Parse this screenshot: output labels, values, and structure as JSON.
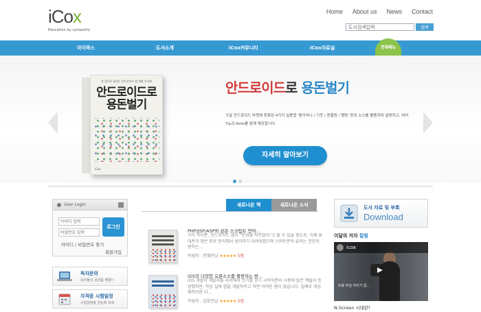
{
  "header": {
    "logo_text_i": "i",
    "logo_text_co": "Co",
    "logo_text_x": "x",
    "logo_tagline": "Education by sympathy",
    "nav": [
      "Home",
      "About us",
      "News",
      "Contact"
    ],
    "search_placeholder": "도서검색입력",
    "search_button": "검색"
  },
  "menu": {
    "items": [
      "아이콕스",
      "도서소개",
      "iCox커뮤니티",
      "iCox자료실"
    ],
    "all_menu": "전체메뉴"
  },
  "banner": {
    "book_top": "한 권으로 끝내는 안드로이드 앱 개발 수익화",
    "book_title_1": "안드로이드로",
    "book_title_2": "용돈벌기",
    "book_pub": "iCox",
    "title_red": "안드로이드",
    "title_mid": "로 ",
    "title_blue": "용돈벌기",
    "desc": "구글 안드로이드 마켓에 등록된 4가지 실용앱 '범거러니 / 기웃 / 동물원 / 행탕' 등의 소스를 활용하여 설명하고, 여러 Tip과 Note를 함께 제공합니다.",
    "button": "자세히 알아보기",
    "slide_count": 2,
    "slide_active": 1
  },
  "login": {
    "header": "User Login",
    "id_placeholder": "아이디 입력",
    "pw_placeholder": "비밀번호 입력",
    "button": "로그인",
    "find": "아이디 / 비밀번호 찾기",
    "join": "회원가입"
  },
  "side_boxes": [
    {
      "title": "독자문의",
      "sub": "독자들의 궁금증 해결!!"
    },
    {
      "title": "자격증 시험일정",
      "sub": "시험일정을 한눈에 쏙쏙"
    }
  ],
  "tabs": [
    "새로나온 책",
    "새로나온 소식"
  ],
  "books": [
    {
      "title": "PHP/JSP/ASP와 같은 스크립트 언어...",
      "desc": "가히 아이폰, 안드로이드 앱이 \"문화를 바꾸었다\"고 할 수 있을 정도로, 이제 휴대폰과 앱은 따로 분리해서 생각하기 어려워졌으며 스마트폰의 유저는 본인이 원하는...",
      "author_label": "작성자 : 한혜진님",
      "stars": "★★★★★",
      "score": "5점"
    },
    {
      "title": "iOS의 다양한 오픈소스를 활용하는 방...",
      "desc": "iOS 개발이 개발자들 사이에서 인기를 얻기 시작하면서 시중에 많은 책들이 등장했지만, 막상 실제 앱을 개발하려고 하면 어려운 점이 많습니다. 일례로 게임제작자한 다...",
      "author_label": "작성자 : 김윤민님",
      "stars": "★★★★★",
      "score": "5점"
    }
  ],
  "download": {
    "title": "도서 자료 및 부록",
    "big": "Download"
  },
  "author": {
    "heading_pre": "이달의 저자 ",
    "heading_hl": "칼럼",
    "video_channel": "icox",
    "video_caption": "또봉 주님 어이가 없...",
    "caption": "N-Screen 시대란?"
  },
  "colors": {
    "primary": "#3799d2",
    "accent_green": "#8cc34a",
    "red": "#d23a3a"
  }
}
